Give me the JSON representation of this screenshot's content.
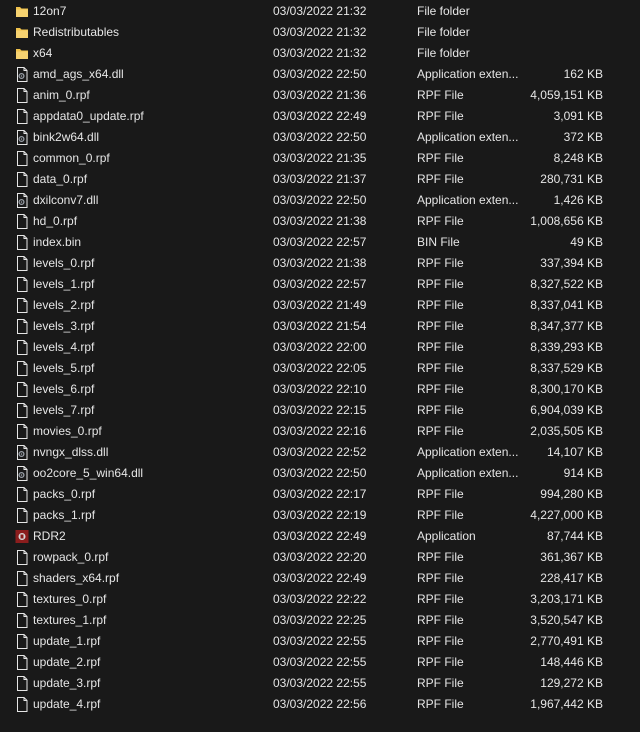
{
  "colors": {
    "background": "#191919",
    "text": "#e6e6e6",
    "folder": "#f0c24c",
    "file_outline": "#e6e6e6",
    "app_icon": "#8b1d1d"
  },
  "files": [
    {
      "name": "12on7",
      "date": "03/03/2022 21:32",
      "type": "File folder",
      "size": "",
      "icon": "folder-icon"
    },
    {
      "name": "Redistributables",
      "date": "03/03/2022 21:32",
      "type": "File folder",
      "size": "",
      "icon": "folder-icon"
    },
    {
      "name": "x64",
      "date": "03/03/2022 21:32",
      "type": "File folder",
      "size": "",
      "icon": "folder-icon"
    },
    {
      "name": "amd_ags_x64.dll",
      "date": "03/03/2022 22:50",
      "type": "Application exten...",
      "size": "162 KB",
      "icon": "dll-file-icon"
    },
    {
      "name": "anim_0.rpf",
      "date": "03/03/2022 21:36",
      "type": "RPF File",
      "size": "4,059,151 KB",
      "icon": "file-icon"
    },
    {
      "name": "appdata0_update.rpf",
      "date": "03/03/2022 22:49",
      "type": "RPF File",
      "size": "3,091 KB",
      "icon": "file-icon"
    },
    {
      "name": "bink2w64.dll",
      "date": "03/03/2022 22:50",
      "type": "Application exten...",
      "size": "372 KB",
      "icon": "dll-file-icon"
    },
    {
      "name": "common_0.rpf",
      "date": "03/03/2022 21:35",
      "type": "RPF File",
      "size": "8,248 KB",
      "icon": "file-icon"
    },
    {
      "name": "data_0.rpf",
      "date": "03/03/2022 21:37",
      "type": "RPF File",
      "size": "280,731 KB",
      "icon": "file-icon"
    },
    {
      "name": "dxilconv7.dll",
      "date": "03/03/2022 22:50",
      "type": "Application exten...",
      "size": "1,426 KB",
      "icon": "dll-file-icon"
    },
    {
      "name": "hd_0.rpf",
      "date": "03/03/2022 21:38",
      "type": "RPF File",
      "size": "1,008,656 KB",
      "icon": "file-icon"
    },
    {
      "name": "index.bin",
      "date": "03/03/2022 22:57",
      "type": "BIN File",
      "size": "49 KB",
      "icon": "file-icon"
    },
    {
      "name": "levels_0.rpf",
      "date": "03/03/2022 21:38",
      "type": "RPF File",
      "size": "337,394 KB",
      "icon": "file-icon"
    },
    {
      "name": "levels_1.rpf",
      "date": "03/03/2022 22:57",
      "type": "RPF File",
      "size": "8,327,522 KB",
      "icon": "file-icon"
    },
    {
      "name": "levels_2.rpf",
      "date": "03/03/2022 21:49",
      "type": "RPF File",
      "size": "8,337,041 KB",
      "icon": "file-icon"
    },
    {
      "name": "levels_3.rpf",
      "date": "03/03/2022 21:54",
      "type": "RPF File",
      "size": "8,347,377 KB",
      "icon": "file-icon"
    },
    {
      "name": "levels_4.rpf",
      "date": "03/03/2022 22:00",
      "type": "RPF File",
      "size": "8,339,293 KB",
      "icon": "file-icon"
    },
    {
      "name": "levels_5.rpf",
      "date": "03/03/2022 22:05",
      "type": "RPF File",
      "size": "8,337,529 KB",
      "icon": "file-icon"
    },
    {
      "name": "levels_6.rpf",
      "date": "03/03/2022 22:10",
      "type": "RPF File",
      "size": "8,300,170 KB",
      "icon": "file-icon"
    },
    {
      "name": "levels_7.rpf",
      "date": "03/03/2022 22:15",
      "type": "RPF File",
      "size": "6,904,039 KB",
      "icon": "file-icon"
    },
    {
      "name": "movies_0.rpf",
      "date": "03/03/2022 22:16",
      "type": "RPF File",
      "size": "2,035,505 KB",
      "icon": "file-icon"
    },
    {
      "name": "nvngx_dlss.dll",
      "date": "03/03/2022 22:52",
      "type": "Application exten...",
      "size": "14,107 KB",
      "icon": "dll-file-icon"
    },
    {
      "name": "oo2core_5_win64.dll",
      "date": "03/03/2022 22:50",
      "type": "Application exten...",
      "size": "914 KB",
      "icon": "dll-file-icon"
    },
    {
      "name": "packs_0.rpf",
      "date": "03/03/2022 22:17",
      "type": "RPF File",
      "size": "994,280 KB",
      "icon": "file-icon"
    },
    {
      "name": "packs_1.rpf",
      "date": "03/03/2022 22:19",
      "type": "RPF File",
      "size": "4,227,000 KB",
      "icon": "file-icon"
    },
    {
      "name": "RDR2",
      "date": "03/03/2022 22:49",
      "type": "Application",
      "size": "87,744 KB",
      "icon": "app-icon"
    },
    {
      "name": "rowpack_0.rpf",
      "date": "03/03/2022 22:20",
      "type": "RPF File",
      "size": "361,367 KB",
      "icon": "file-icon"
    },
    {
      "name": "shaders_x64.rpf",
      "date": "03/03/2022 22:49",
      "type": "RPF File",
      "size": "228,417 KB",
      "icon": "file-icon"
    },
    {
      "name": "textures_0.rpf",
      "date": "03/03/2022 22:22",
      "type": "RPF File",
      "size": "3,203,171 KB",
      "icon": "file-icon"
    },
    {
      "name": "textures_1.rpf",
      "date": "03/03/2022 22:25",
      "type": "RPF File",
      "size": "3,520,547 KB",
      "icon": "file-icon"
    },
    {
      "name": "update_1.rpf",
      "date": "03/03/2022 22:55",
      "type": "RPF File",
      "size": "2,770,491 KB",
      "icon": "file-icon"
    },
    {
      "name": "update_2.rpf",
      "date": "03/03/2022 22:55",
      "type": "RPF File",
      "size": "148,446 KB",
      "icon": "file-icon"
    },
    {
      "name": "update_3.rpf",
      "date": "03/03/2022 22:55",
      "type": "RPF File",
      "size": "129,272 KB",
      "icon": "file-icon"
    },
    {
      "name": "update_4.rpf",
      "date": "03/03/2022 22:56",
      "type": "RPF File",
      "size": "1,967,442 KB",
      "icon": "file-icon"
    }
  ]
}
